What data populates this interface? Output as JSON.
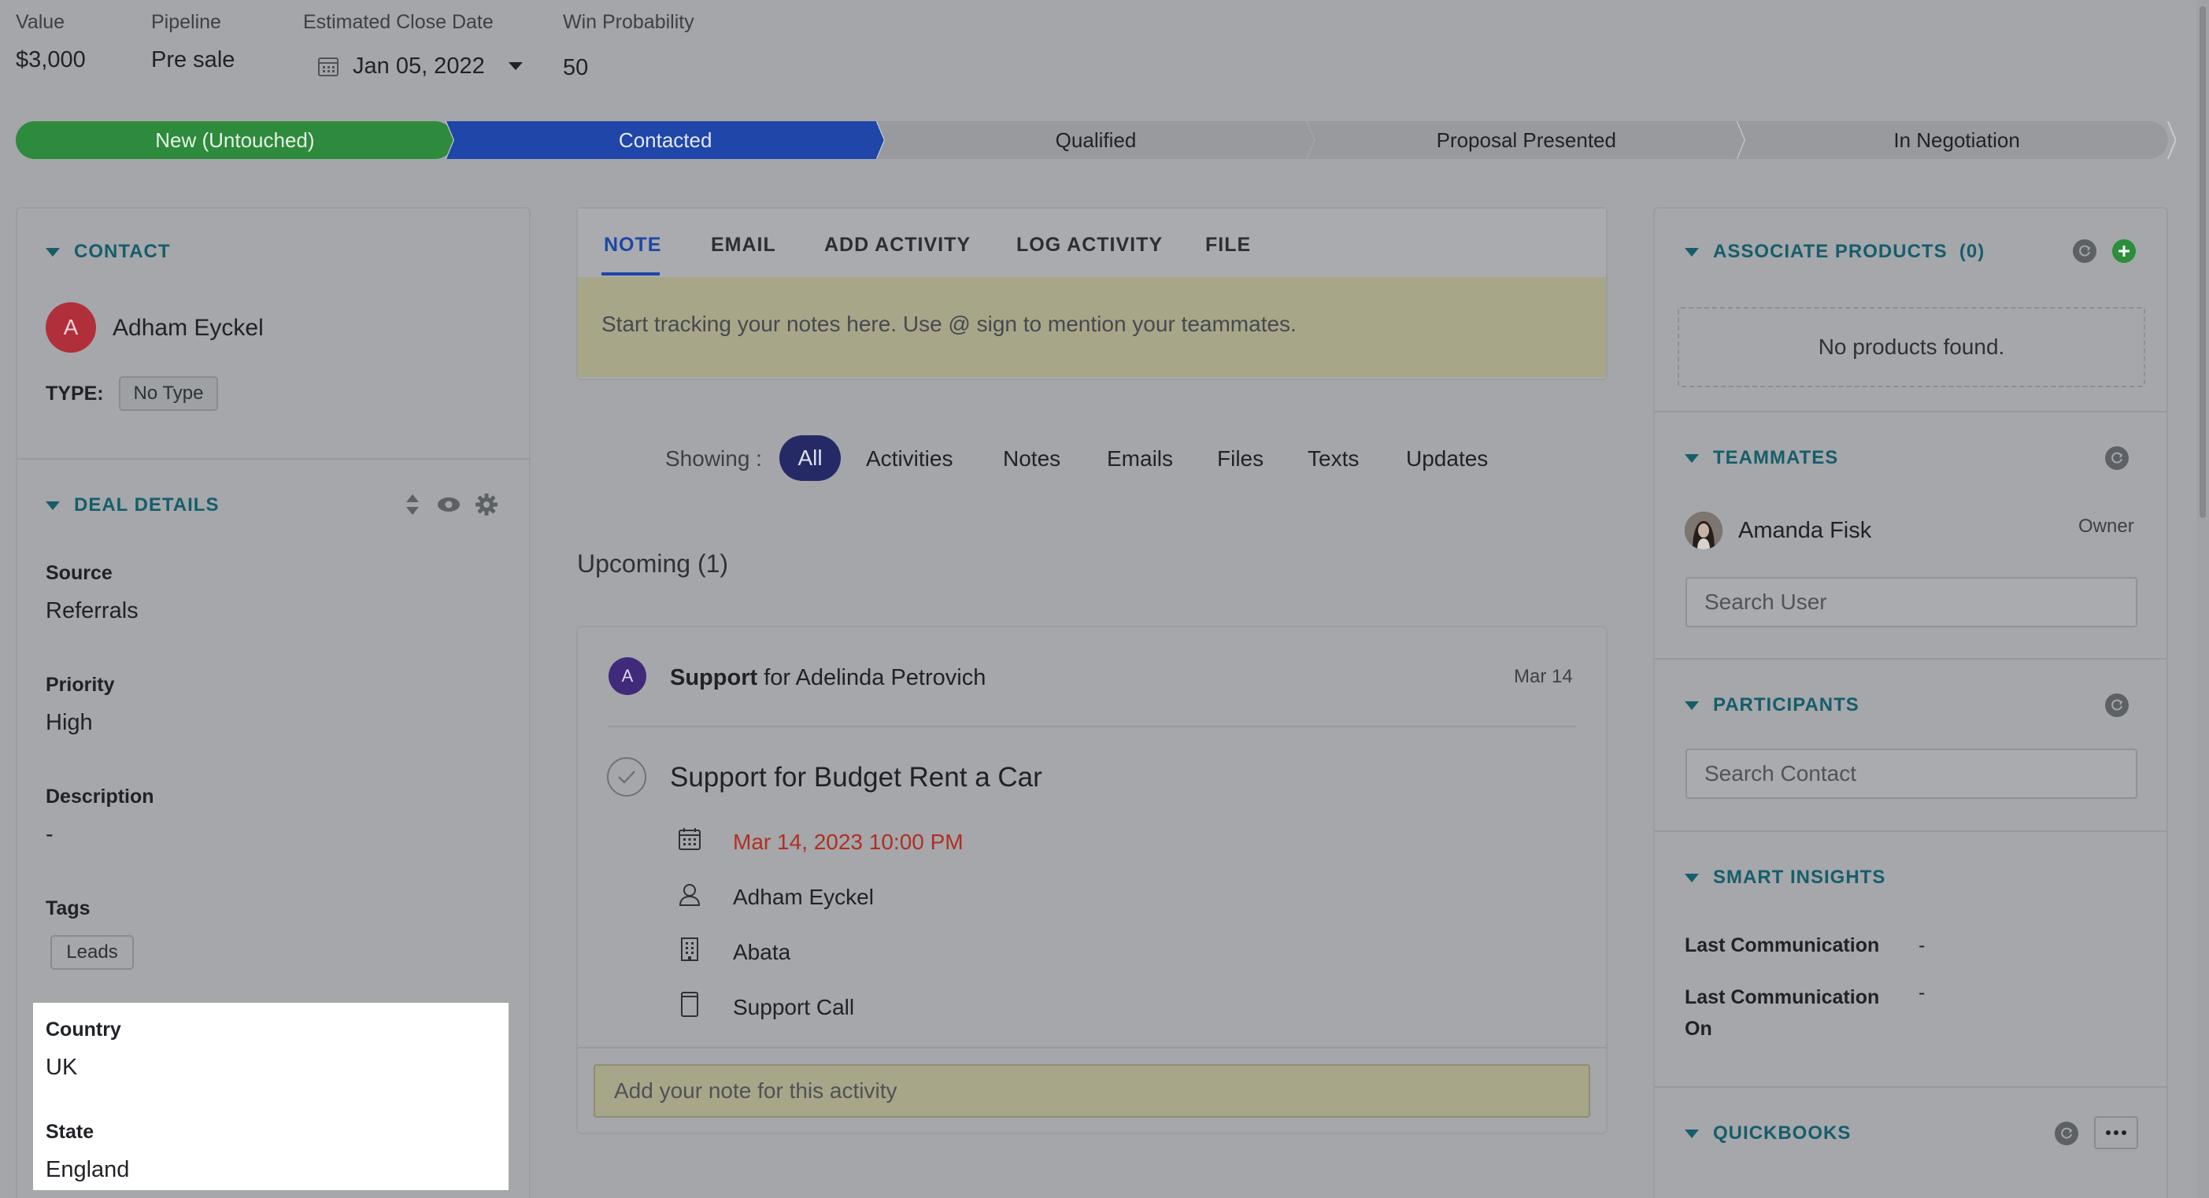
{
  "header": {
    "value_label": "Value",
    "value": "$3,000",
    "pipeline_label": "Pipeline",
    "pipeline": "Pre sale",
    "close_date_label": "Estimated Close Date",
    "close_date": "Jan 05, 2022",
    "win_prob_label": "Win Probability",
    "win_prob": "50"
  },
  "stages": [
    "New (Untouched)",
    "Contacted",
    "Qualified",
    "Proposal Presented",
    "In Negotiation"
  ],
  "colors": {
    "stage_done": "#2e8a3c",
    "stage_current": "#1f46a8",
    "stage_todo": "#989a9e",
    "accent": "#165d6b",
    "date_red": "#b02f24"
  },
  "contact": {
    "title": "CONTACT",
    "avatar_initial": "A",
    "name": "Adham Eyckel",
    "type_label": "TYPE:",
    "type_value": "No Type"
  },
  "deal_details": {
    "title": "DEAL DETAILS",
    "source_label": "Source",
    "source": "Referrals",
    "priority_label": "Priority",
    "priority": "High",
    "description_label": "Description",
    "description": "-",
    "tags_label": "Tags",
    "tag": "Leads",
    "country_label": "Country",
    "country": "UK",
    "state_label": "State",
    "state": "England"
  },
  "composer": {
    "tabs": [
      "NOTE",
      "EMAIL",
      "ADD ACTIVITY",
      "LOG ACTIVITY",
      "FILE"
    ],
    "placeholder": "Start tracking your notes here. Use @ sign to mention your teammates."
  },
  "filters": {
    "label": "Showing :",
    "items": [
      "All",
      "Activities",
      "Notes",
      "Emails",
      "Files",
      "Texts",
      "Updates"
    ]
  },
  "upcoming": {
    "heading": "Upcoming (1)",
    "avatar_initial": "A",
    "activity_type": "Support",
    "for_text": "for Adelinda Petrovich",
    "date_short": "Mar 14",
    "title": "Support for Budget Rent a Car",
    "datetime": "Mar 14, 2023 10:00 PM",
    "contact": "Adham Eyckel",
    "company": "Abata",
    "call_type": "Support Call",
    "note_placeholder": "Add your note for this activity"
  },
  "right": {
    "products_title": "ASSOCIATE PRODUCTS",
    "products_count": "(0)",
    "no_products": "No products found.",
    "teammates_title": "TEAMMATES",
    "teammate_name": "Amanda Fisk",
    "teammate_role": "Owner",
    "search_user_placeholder": "Search User",
    "participants_title": "PARTICIPANTS",
    "search_contact_placeholder": "Search Contact",
    "insights_title": "SMART INSIGHTS",
    "last_comm_label": "Last Communication",
    "last_comm_value": "-",
    "last_comm_on_label": "Last Communication On",
    "last_comm_on_value": "-",
    "quickbooks_title": "QUICKBOOKS"
  }
}
